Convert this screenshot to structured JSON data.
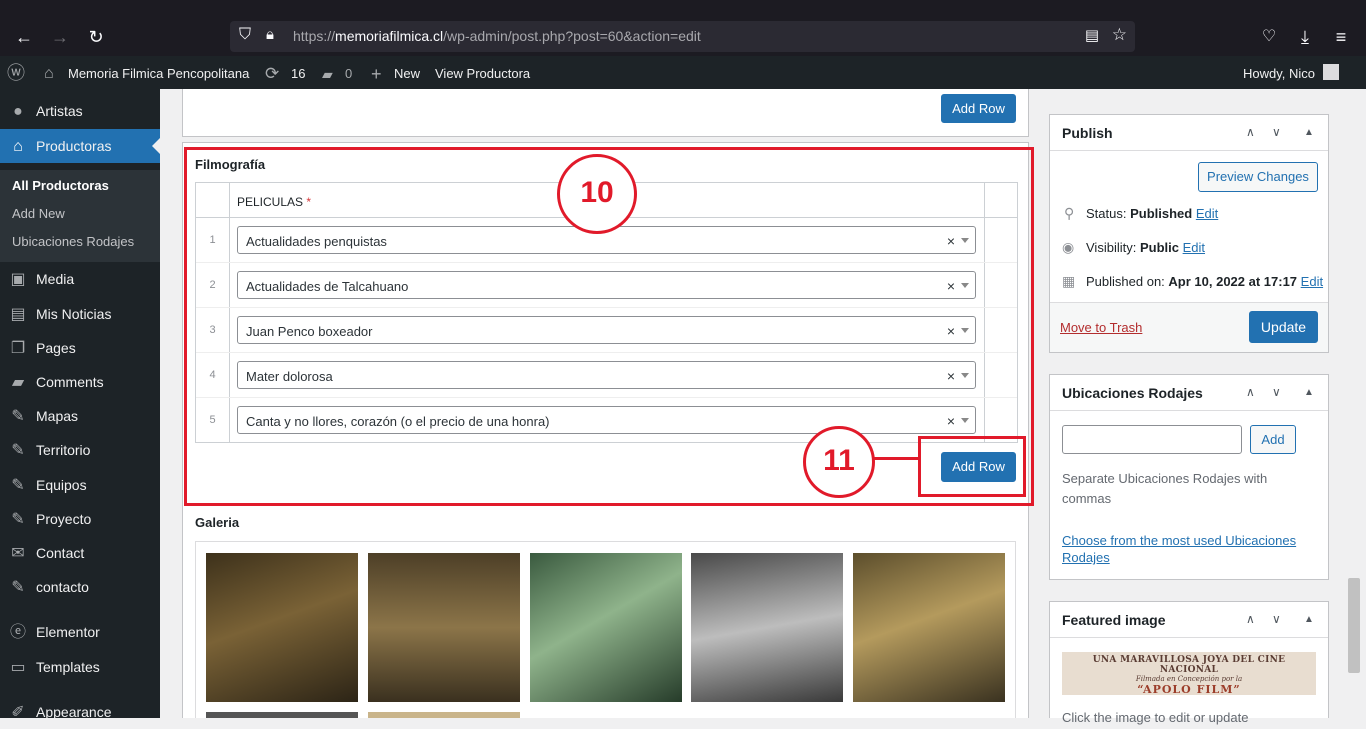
{
  "browser": {
    "url_prefix": "https://",
    "url_host": "memoriafilmica.cl",
    "url_path": "/wp-admin/post.php?post=60&action=edit"
  },
  "adminbar": {
    "site_name": "Memoria Filmica Pencopolitana",
    "updates_count": "16",
    "comments_count": "0",
    "new_label": "New",
    "view_label": "View Productora",
    "howdy": "Howdy, Nico"
  },
  "sidebar": {
    "items": [
      {
        "label": "Artistas",
        "icon": "person-icon"
      },
      {
        "label": "Productoras",
        "icon": "home-icon"
      },
      {
        "label": "Media",
        "icon": "media-icon"
      },
      {
        "label": "Mis Noticias",
        "icon": "document-icon"
      },
      {
        "label": "Pages",
        "icon": "pages-icon"
      },
      {
        "label": "Comments",
        "icon": "comment-icon"
      },
      {
        "label": "Mapas",
        "icon": "pin-icon"
      },
      {
        "label": "Territorio",
        "icon": "pin-icon"
      },
      {
        "label": "Equipos",
        "icon": "pin-icon"
      },
      {
        "label": "Proyecto",
        "icon": "pin-icon"
      },
      {
        "label": "Contact",
        "icon": "mail-icon"
      },
      {
        "label": "contacto",
        "icon": "pin-icon"
      },
      {
        "label": "Elementor",
        "icon": "elementor-icon"
      },
      {
        "label": "Templates",
        "icon": "folder-icon"
      },
      {
        "label": "Appearance",
        "icon": "brush-icon"
      }
    ],
    "submenu": [
      "All Productoras",
      "Add New",
      "Ubicaciones Rodajes"
    ]
  },
  "main": {
    "add_row_label": "Add Row",
    "filmografia_title": "Filmografía",
    "column_header": "PELICULAS",
    "required_mark": "*",
    "rows": [
      {
        "num": "1",
        "value": "Actualidades penquistas"
      },
      {
        "num": "2",
        "value": "Actualidades de Talcahuano"
      },
      {
        "num": "3",
        "value": "Juan Penco boxeador"
      },
      {
        "num": "4",
        "value": "Mater dolorosa"
      },
      {
        "num": "5",
        "value": "Canta y no llores, corazón (o el precio de una honra)"
      }
    ],
    "galeria_title": "Galeria"
  },
  "annotations": {
    "first": "10",
    "second": "11"
  },
  "publish": {
    "title": "Publish",
    "preview": "Preview Changes",
    "status_label": "Status:",
    "status_value": "Published",
    "visibility_label": "Visibility:",
    "visibility_value": "Public",
    "published_label": "Published on:",
    "published_value": "Apr 10, 2022 at 17:17",
    "edit": "Edit",
    "trash": "Move to Trash",
    "update": "Update"
  },
  "ubicaciones": {
    "title": "Ubicaciones Rodajes",
    "add": "Add",
    "help": "Separate Ubicaciones Rodajes with commas",
    "choose": "Choose from the most used Ubicaciones Rodajes"
  },
  "featured": {
    "title": "Featured image",
    "img_line1": "UNA MARAVILLOSA JOYA DEL CINE NACIONAL",
    "img_line2": "Filmada en Concepción por la",
    "img_line3": "“APOLO FILM”",
    "caption": "Click the image to edit or update"
  }
}
